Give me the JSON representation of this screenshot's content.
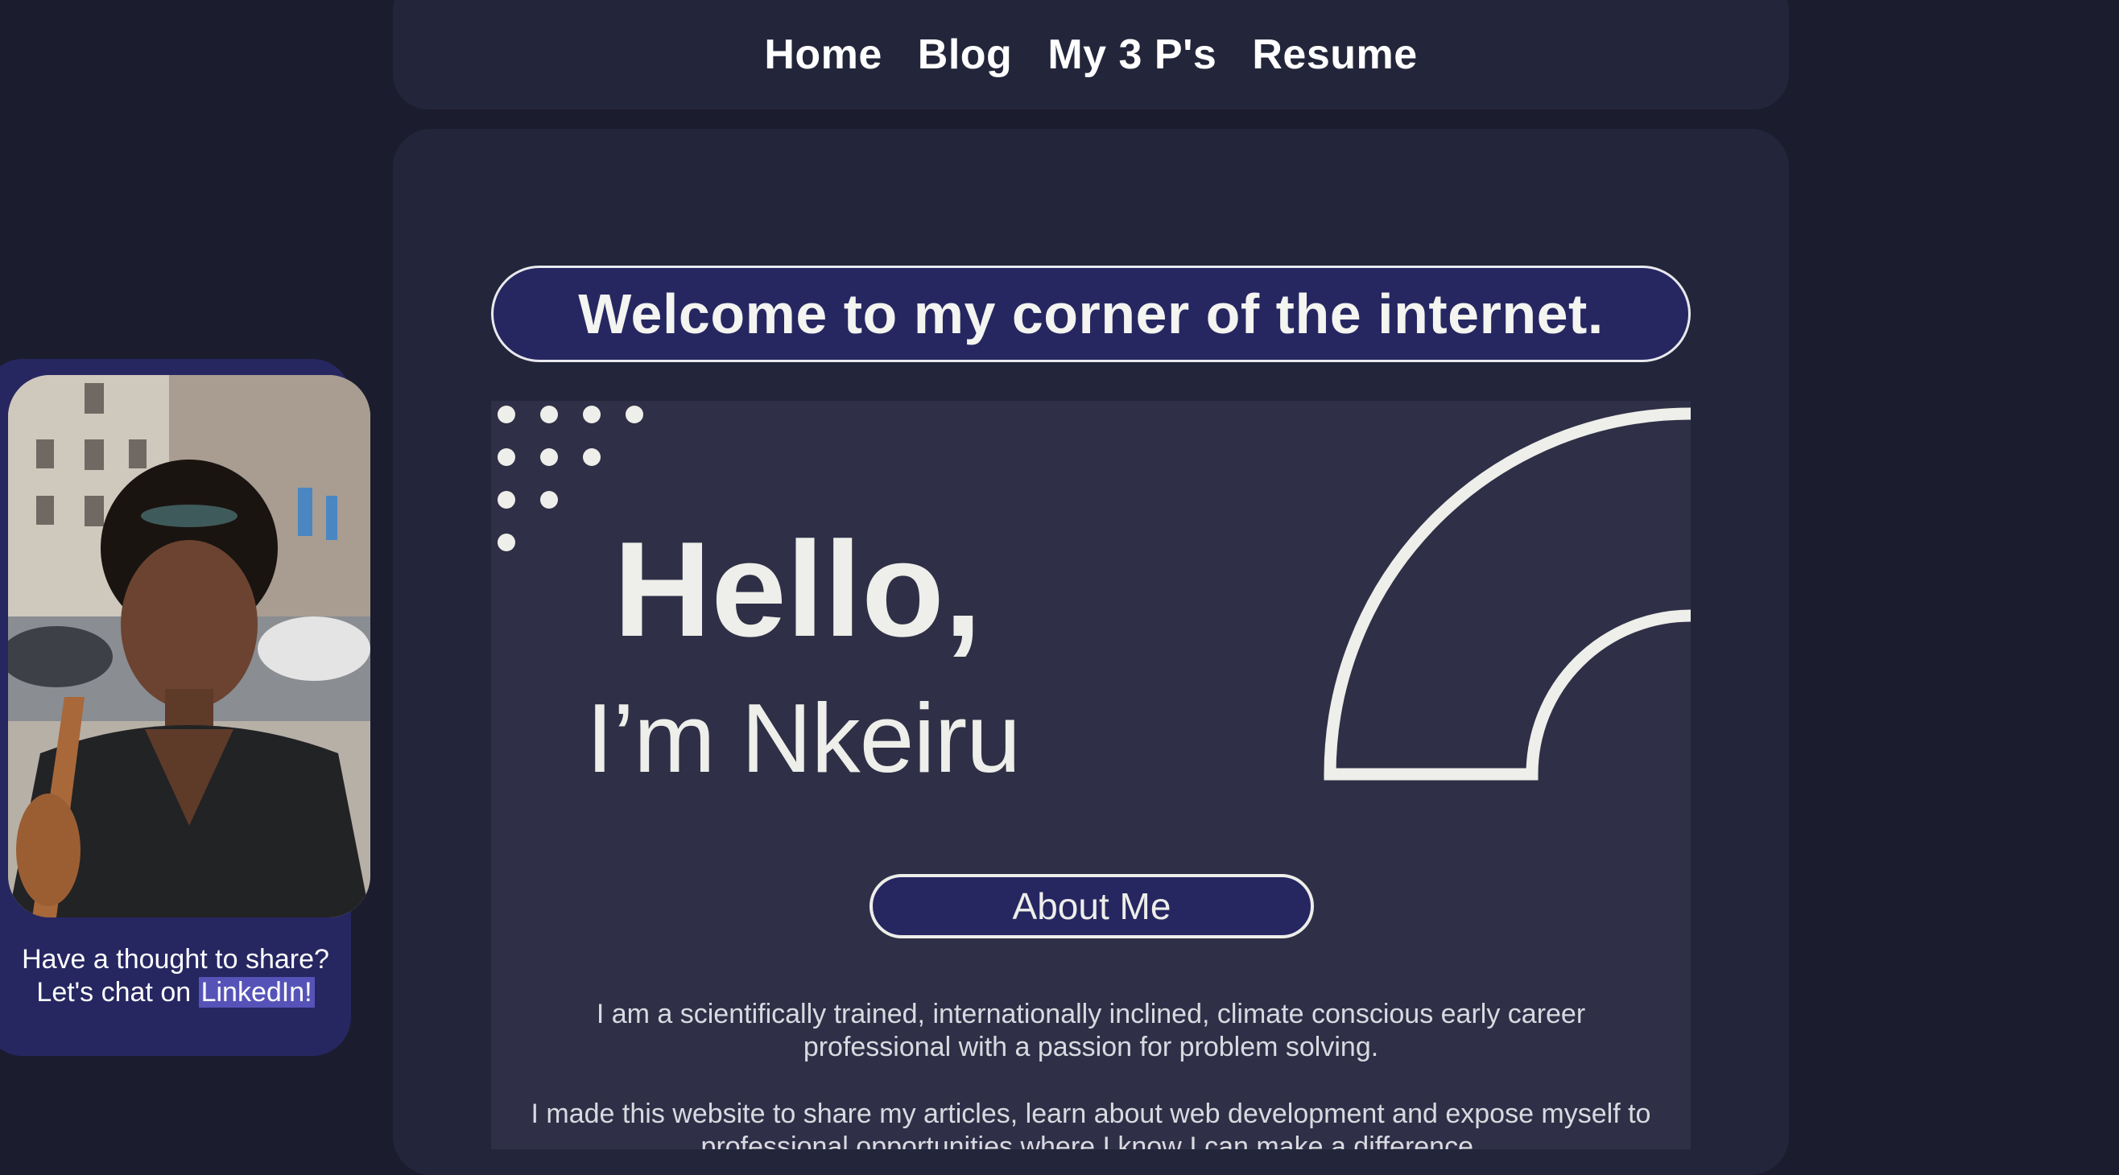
{
  "nav": {
    "items": [
      {
        "label": "Home"
      },
      {
        "label": "Blog"
      },
      {
        "label": "My 3 P's"
      },
      {
        "label": "Resume"
      }
    ]
  },
  "welcome": {
    "text": "Welcome to my corner of the internet."
  },
  "hero": {
    "greeting": "Hello,",
    "name": "I’m Nkeiru",
    "about_button": "About Me",
    "bio_paragraph_1": "I am a scientifically trained, internationally inclined, climate conscious early career professional with a passion for problem solving.",
    "bio_paragraph_2": "I made this website to share my articles, learn about web development  and expose myself to professional opportunities where I know I can make a difference."
  },
  "sidebar": {
    "line1": "Have a thought to share?",
    "line2_prefix": "Let's chat on ",
    "link_label": "LinkedIn!"
  },
  "colors": {
    "page_bg": "#1b1c2e",
    "panel_bg": "#23263a",
    "hero_bg": "#2f3047",
    "accent_navy": "#262761",
    "link_highlight": "#5653b8",
    "cream": "#eeeeea"
  }
}
